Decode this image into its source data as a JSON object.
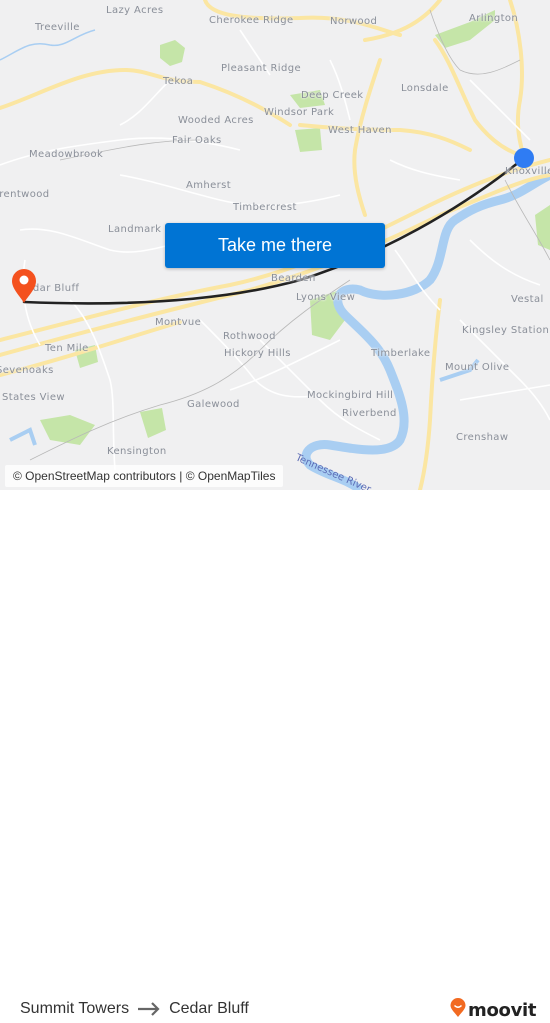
{
  "map": {
    "places": [
      {
        "name": "Lazy Acres"
      },
      {
        "name": "Treeville"
      },
      {
        "name": "Cherokee Ridge"
      },
      {
        "name": "Norwood"
      },
      {
        "name": "Arlington"
      },
      {
        "name": "Pleasant Ridge"
      },
      {
        "name": "Tekoa"
      },
      {
        "name": "Deep Creek"
      },
      {
        "name": "Lonsdale"
      },
      {
        "name": "Windsor Park"
      },
      {
        "name": "Wooded Acres"
      },
      {
        "name": "West Haven"
      },
      {
        "name": "Fair Oaks"
      },
      {
        "name": "Meadowbrook"
      },
      {
        "name": "Amherst"
      },
      {
        "name": "Brentwood"
      },
      {
        "name": "Timbercrest"
      },
      {
        "name": "Landmark"
      },
      {
        "name": "Cedar Bluff"
      },
      {
        "name": "Bearden"
      },
      {
        "name": "Lyons View"
      },
      {
        "name": "Knoxville"
      },
      {
        "name": "Montvue"
      },
      {
        "name": "Vestal"
      },
      {
        "name": "Ten Mile"
      },
      {
        "name": "Rothwood"
      },
      {
        "name": "Kingsley Station"
      },
      {
        "name": "Hickory Hills"
      },
      {
        "name": "Sevenoaks"
      },
      {
        "name": "Timberlake"
      },
      {
        "name": "Mount Olive"
      },
      {
        "name": "States View"
      },
      {
        "name": "Mockingbird Hill"
      },
      {
        "name": "Galewood"
      },
      {
        "name": "Riverbend"
      },
      {
        "name": "Crenshaw"
      },
      {
        "name": "Kensington"
      }
    ],
    "river_label": "Tennessee River",
    "attribution": "© OpenStreetMap contributors | © OpenMapTiles",
    "colors": {
      "background": "#f0f0f1",
      "water": "#a9cef2",
      "park": "#c5e5a8",
      "major_road": "#fbe6a2",
      "route_line": "#222222",
      "origin": "#2f7cf3",
      "destination": "#f4511e",
      "button": "#0074d4"
    }
  },
  "cta": {
    "label": "Take me there"
  },
  "route": {
    "origin": "Summit Towers",
    "destination": "Cedar Bluff",
    "arrow_icon": "arrow-right-icon"
  },
  "brand": {
    "name": "moovit",
    "accent": "#f26a21"
  }
}
